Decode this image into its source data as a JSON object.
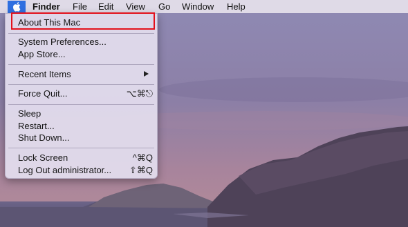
{
  "menubar": {
    "finder": "Finder",
    "file": "File",
    "edit": "Edit",
    "view": "View",
    "go": "Go",
    "window": "Window",
    "help": "Help"
  },
  "apple_menu": {
    "about": "About This Mac",
    "system_preferences": "System Preferences...",
    "app_store": "App Store...",
    "recent_items": "Recent Items",
    "force_quit": "Force Quit...",
    "force_quit_shortcut": "⌥⌘⎋",
    "sleep": "Sleep",
    "restart": "Restart...",
    "shut_down": "Shut Down...",
    "lock_screen": "Lock Screen",
    "lock_screen_shortcut": "^⌘Q",
    "log_out": "Log Out administrator...",
    "log_out_shortcut": "⇧⌘Q"
  },
  "colors": {
    "highlight": "#e3101b",
    "apple_accent": "#2f6fe0"
  },
  "icons": {
    "apple": "apple-icon",
    "submenu": "chevron-right-icon"
  }
}
